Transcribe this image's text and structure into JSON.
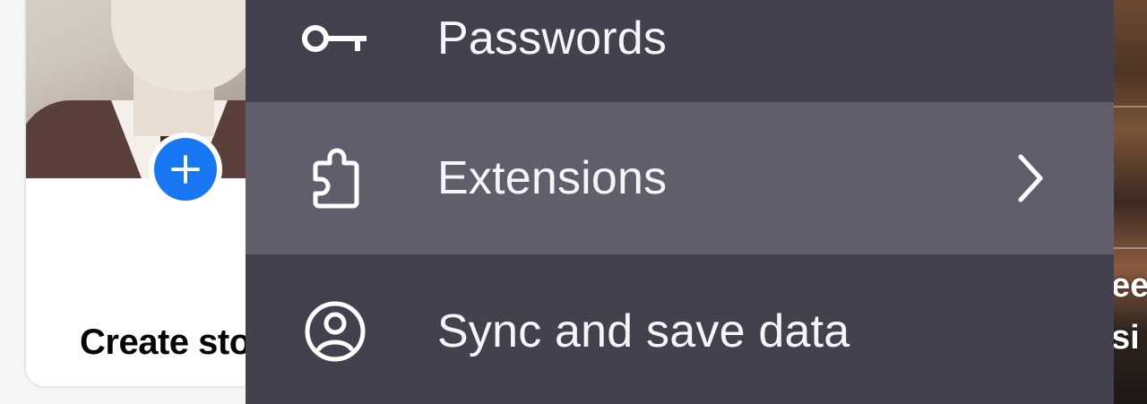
{
  "background": {
    "story_card": {
      "label": "Create sto",
      "add_icon": "plus-icon",
      "accent_color": "#1877f2"
    },
    "right_strip": {
      "text_lines": [
        "ee",
        "si"
      ]
    }
  },
  "menu": {
    "background_color": "#44414f",
    "highlight_color": "#605e6a",
    "items": [
      {
        "label": "Passwords",
        "icon": "key-icon",
        "has_submenu": false,
        "highlighted": false
      },
      {
        "label": "Extensions",
        "icon": "puzzle-piece-icon",
        "has_submenu": true,
        "highlighted": true
      },
      {
        "label": "Sync and save data",
        "icon": "account-circle-icon",
        "has_submenu": false,
        "highlighted": false
      }
    ]
  }
}
